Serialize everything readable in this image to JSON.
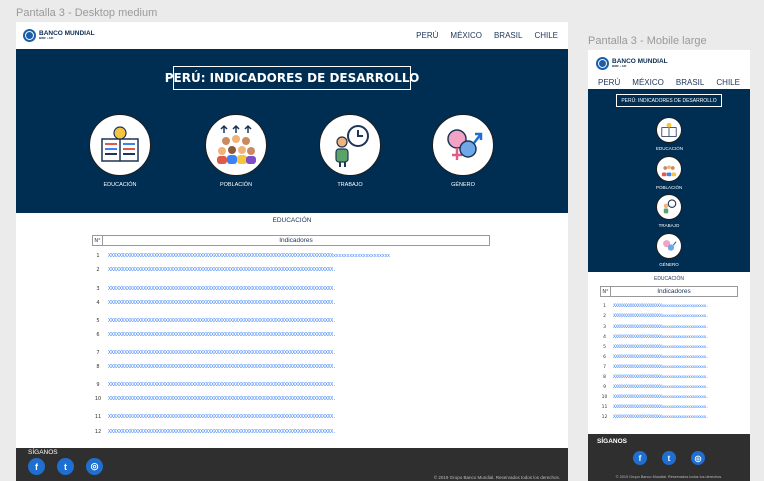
{
  "frames": {
    "desktop_label": "Pantalla 3 - Desktop medium",
    "mobile_label": "Pantalla 3 - Mobile large"
  },
  "brand": {
    "name": "BANCO MUNDIAL",
    "sub": "BIRF • AIF"
  },
  "nav": [
    "PERÚ",
    "MÉXICO",
    "BRASIL",
    "CHILE"
  ],
  "hero": {
    "title": "PERÚ: INDICADORES DE DESARROLLO",
    "categories": [
      {
        "label": "EDUCACIÓN",
        "icon": "book-lightbulb-icon"
      },
      {
        "label": "POBLACIÓN",
        "icon": "population-icon"
      },
      {
        "label": "TRABAJO",
        "icon": "worker-clock-icon"
      },
      {
        "label": "GÉNERO",
        "icon": "gender-icon"
      }
    ]
  },
  "section": "EDUCACIÓN",
  "table": {
    "col_num": "N°",
    "col_indicators": "Indicadores",
    "rows": [
      {
        "n": "1",
        "text": "XXXXXXXXXXXXXXXXXXXXXXXXXXXXXXXXXXXXXXXXXXXXXXXXXXXXXXXXXXXXXXXXXXXXXXXXXXXXXXXXXXXxxxxxxxxxxxxxxxxxxxxx"
      },
      {
        "n": "2",
        "text": "XXXXXXXXXXXXXXXXXXXXXXXXXXXXXXXXXXXXXXXXXXXXXXXXXXXXXXXXXXXXXXXXXXXXXXXXXXXXXXXXXXX."
      },
      {
        "n": "3",
        "text": "XXXXXXXXXXXXXXXXXXXXXXXXXXXXXXXXXXXXXXXXXXXXXXXXXXXXXXXXXXXXXXXXXXXXXXXXXXXXXXXXXXX."
      },
      {
        "n": "4",
        "text": "XXXXXXXXXXXXXXXXXXXXXXXXXXXXXXXXXXXXXXXXXXXXXXXXXXXXXXXXXXXXXXXXXXXXXXXXXXXXXXXXXXX."
      },
      {
        "n": "5",
        "text": "XXXXXXXXXXXXXXXXXXXXXXXXXXXXXXXXXXXXXXXXXXXXXXXXXXXXXXXXXXXXXXXXXXXXXXXXXXXXXXXXXXX."
      },
      {
        "n": "6",
        "text": "XXXXXXXXXXXXXXXXXXXXXXXXXXXXXXXXXXXXXXXXXXXXXXXXXXXXXXXXXXXXXXXXXXXXXXXXXXXXXXXXXXX."
      },
      {
        "n": "7",
        "text": "XXXXXXXXXXXXXXXXXXXXXXXXXXXXXXXXXXXXXXXXXXXXXXXXXXXXXXXXXXXXXXXXXXXXXXXXXXXXXXXXXXX."
      },
      {
        "n": "8",
        "text": "XXXXXXXXXXXXXXXXXXXXXXXXXXXXXXXXXXXXXXXXXXXXXXXXXXXXXXXXXXXXXXXXXXXXXXXXXXXXXXXXXXX."
      },
      {
        "n": "9",
        "text": "XXXXXXXXXXXXXXXXXXXXXXXXXXXXXXXXXXXXXXXXXXXXXXXXXXXXXXXXXXXXXXXXXXXXXXXXXXXXXXXXXXX."
      },
      {
        "n": "10",
        "text": "XXXXXXXXXXXXXXXXXXXXXXXXXXXXXXXXXXXXXXXXXXXXXXXXXXXXXXXXXXXXXXXXXXXXXXXXXXXXXXXXXXX."
      },
      {
        "n": "11",
        "text": "XXXXXXXXXXXXXXXXXXXXXXXXXXXXXXXXXXXXXXXXXXXXXXXXXXXXXXXXXXXXXXXXXXXXXXXXXXXXXXXXXXX."
      },
      {
        "n": "12",
        "text": "XXXXXXXXXXXXXXXXXXXXXXXXXXXXXXXXXXXXXXXXXXXXXXXXXXXXXXXXXXXXXXXXXXXXXXXXXXXXXXXXXXX."
      }
    ],
    "mobile_text": "XXXXXXXXXXXXXXXXXXXXXXxxxxxxxxxxxxxxxxxxxx."
  },
  "footer": {
    "follow": "SÍGANOS",
    "copyright": "© 2019 Grupo Banco Mundial. Reservados todos los derechos.",
    "social": [
      "facebook-icon",
      "twitter-icon",
      "instagram-icon"
    ]
  },
  "colors": {
    "hero": "#002e52",
    "footer": "#2f2f2f",
    "link": "#3b82f6",
    "social": "#1f6fd0"
  }
}
